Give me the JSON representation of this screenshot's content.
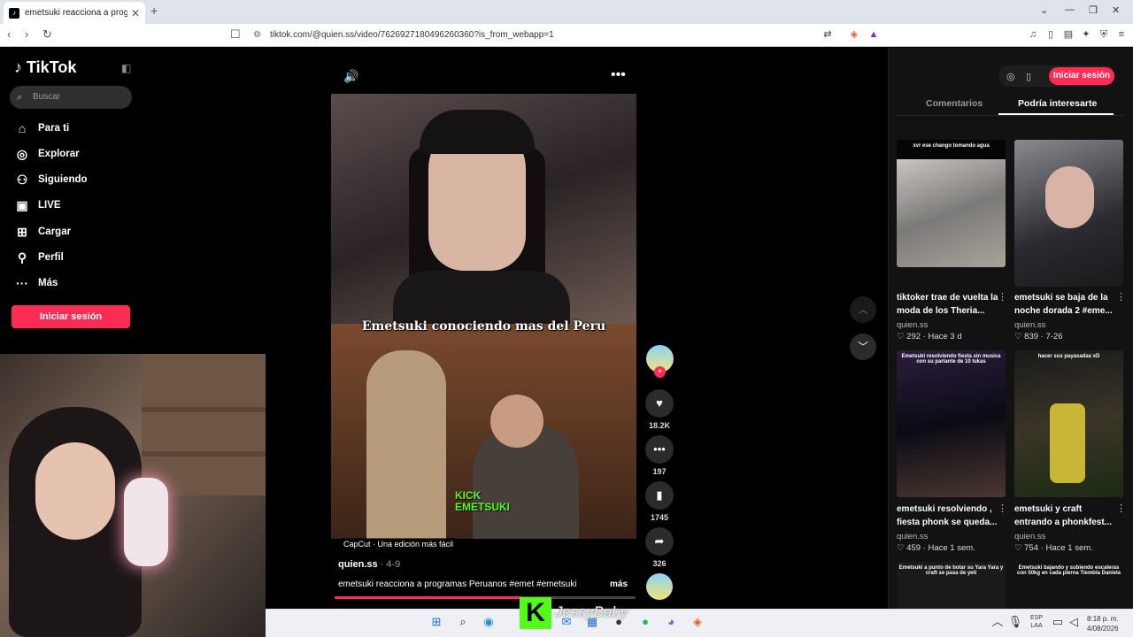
{
  "browser": {
    "tab_title": "emetsuki reacciona a programas",
    "tab_icon": "tiktok-favicon",
    "new_tab": "+",
    "url": "tiktok.com/@quien.ss/video/7626927180496260360?is_from_webapp=1"
  },
  "sidebar": {
    "logo": "TikTok",
    "search_placeholder": "Buscar",
    "items": [
      {
        "label": "Para ti",
        "icon": "home-icon"
      },
      {
        "label": "Explorar",
        "icon": "compass-icon"
      },
      {
        "label": "Siguiendo",
        "icon": "following-icon"
      },
      {
        "label": "LIVE",
        "icon": "live-icon"
      },
      {
        "label": "Cargar",
        "icon": "upload-icon"
      },
      {
        "label": "Perfil",
        "icon": "profile-icon"
      },
      {
        "label": "Más",
        "icon": "more-icon"
      }
    ],
    "login": "Iniciar sesión"
  },
  "video": {
    "overlay_title": "Emetsuki conociendo mas del Peru",
    "overlay_kick": "KICK",
    "overlay_name": "EMETSUKI",
    "capcut": "CapCut · Una edición más fácil",
    "author": "quien.ss",
    "date": " · 4-9",
    "caption": "emetsuki reacciona a programas Peruanos #emet #emetsuki",
    "more": "más",
    "progress": 0.62
  },
  "actions": {
    "likes": "18.2K",
    "comments": "197",
    "saves": "1745",
    "shares": "326"
  },
  "right_panel": {
    "login": "Iniciar sesión",
    "tab_comments": "Comentarios",
    "tab_suggested": "Podría interesarte",
    "videos": [
      {
        "caption_overlay": "xvr ese chango tomando agua",
        "title": "tiktoker trae de vuelta la moda de los Theria...",
        "user": "quien.ss",
        "likes": "292",
        "time": "Hace 3 d"
      },
      {
        "caption_overlay": "",
        "title": "emetsuki se baja de la noche dorada 2 #eme...",
        "user": "quien.ss",
        "likes": "839",
        "time": "7-26"
      },
      {
        "caption_overlay": "Emetsuki resolviendo fiesta sin musica con su pariante de 10 lukas",
        "title": "emetsuki resolviendo , fiesta phonk se queda...",
        "user": "quien.ss",
        "likes": "459",
        "time": "Hace 1 sem."
      },
      {
        "caption_overlay": "hacer sus payasadas xD",
        "title": "emetsuki y craft entrando a phonkfest...",
        "user": "quien.ss",
        "likes": "754",
        "time": "Hace 1 sem."
      },
      {
        "caption_overlay": "Emetsuki a punto de botar su Yara Yara y craft se pasa de yeti",
        "title": "",
        "user": "",
        "likes": "",
        "time": ""
      },
      {
        "caption_overlay": "Emetsuki bajando y subiendo escaleras con 50kg en cada pierna Tiembla Daniela",
        "title": "",
        "user": "",
        "likes": "",
        "time": ""
      }
    ]
  },
  "taskbar": {
    "stream_name": "JessyBaby",
    "kick_letter": "K",
    "lang1": "ESP",
    "lang2": "LAA",
    "time": "8:18 p. m.",
    "date": "4/08/2026"
  },
  "colors": {
    "accent": "#fe2c55",
    "kick_green": "#53fc18"
  }
}
